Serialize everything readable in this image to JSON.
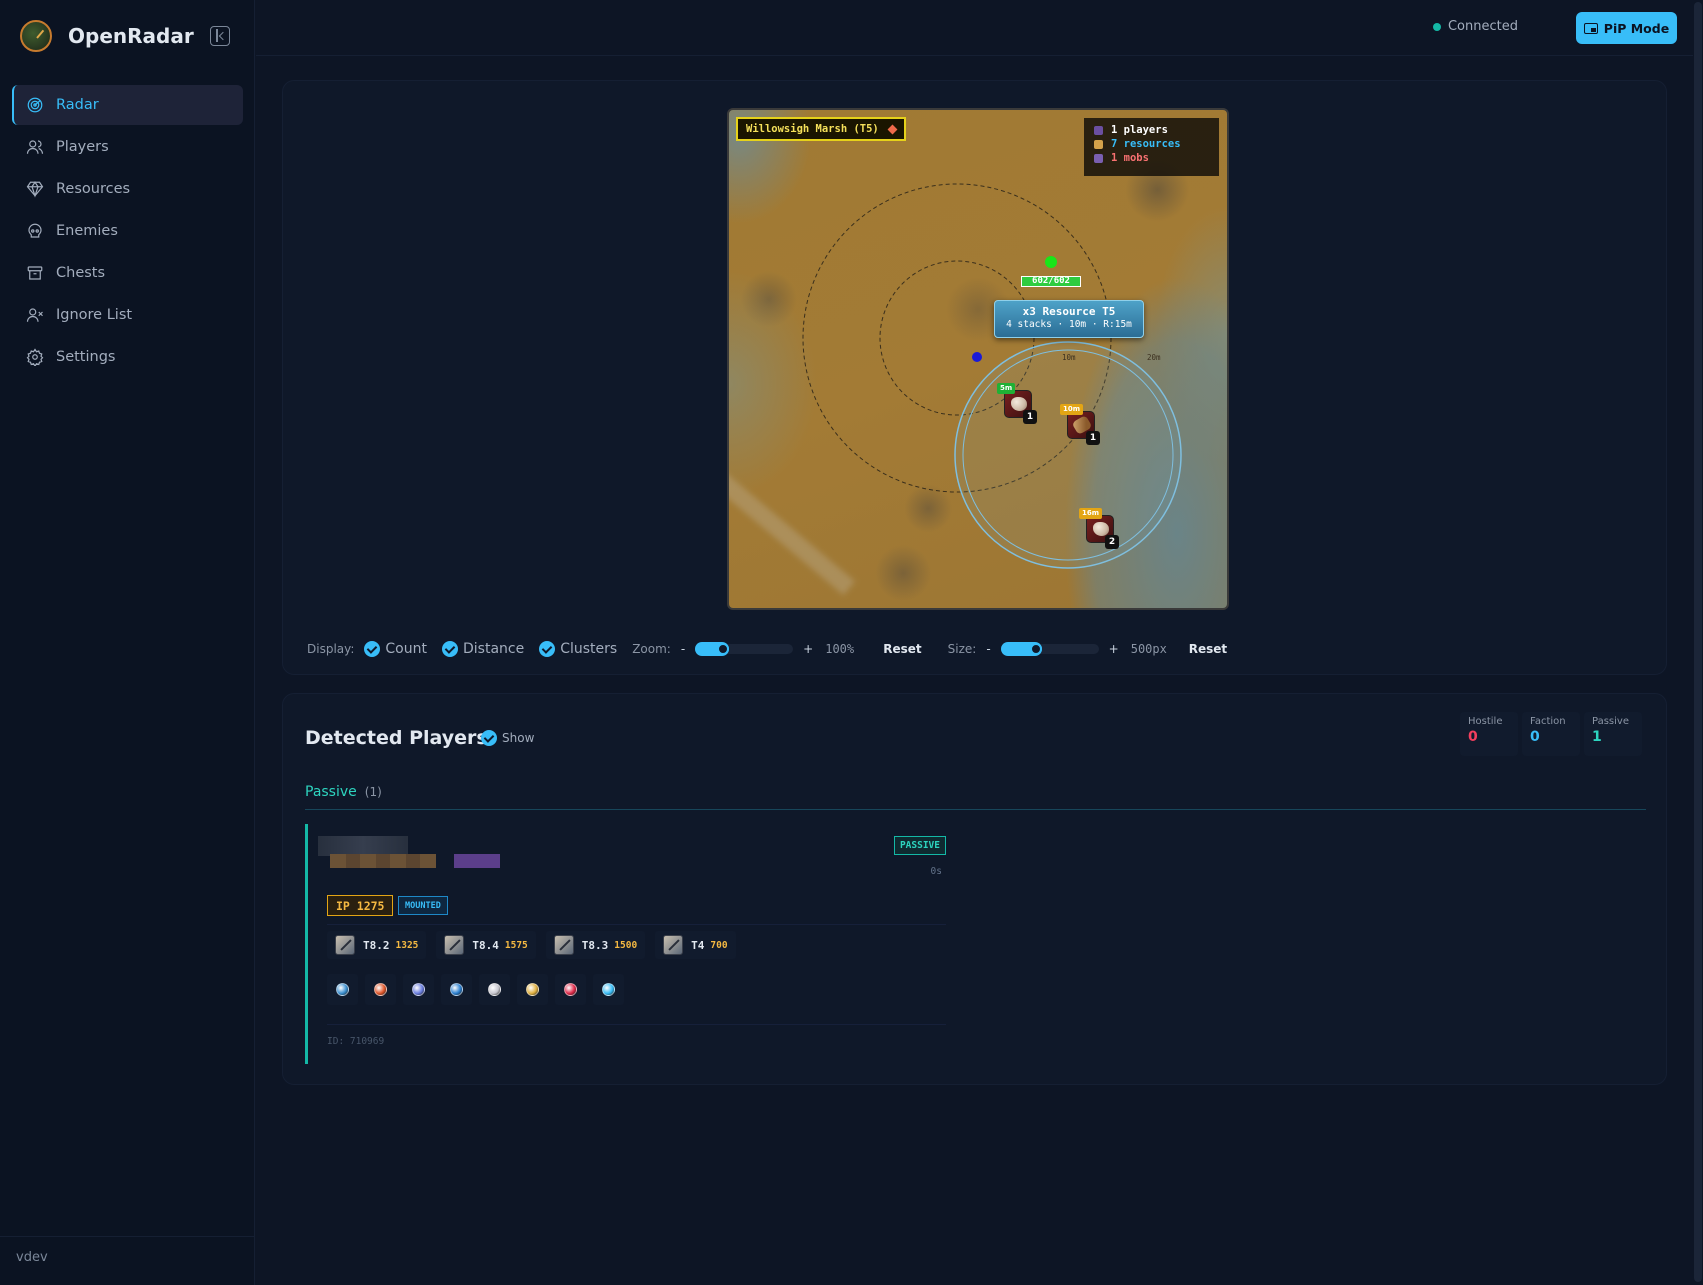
{
  "app": {
    "title": "OpenRadar",
    "version": "vdev"
  },
  "sidebar": {
    "items": [
      {
        "label": "Radar",
        "icon": "radar-icon",
        "active": true
      },
      {
        "label": "Players",
        "icon": "users-icon"
      },
      {
        "label": "Resources",
        "icon": "gem-icon"
      },
      {
        "label": "Enemies",
        "icon": "skull-icon"
      },
      {
        "label": "Chests",
        "icon": "archive-icon"
      },
      {
        "label": "Ignore List",
        "icon": "user-x-icon"
      },
      {
        "label": "Settings",
        "icon": "gear-icon"
      }
    ]
  },
  "topbar": {
    "status": "Connected",
    "pip_label": "PiP Mode"
  },
  "radar": {
    "zone": "Willowsigh Marsh (T5)",
    "legend": {
      "players": "1 players",
      "resources": "7 resources",
      "mobs": "1 mobs"
    },
    "ring_labels": [
      "10m",
      "20m"
    ],
    "hp": "602/602",
    "tooltip_title": "x3 Resource T5",
    "tooltip_sub": "4 stacks · 10m · R:15m",
    "resources": [
      {
        "dist": "5m",
        "count": "1",
        "kind": "rock"
      },
      {
        "dist": "10m",
        "count": "1",
        "kind": "wood"
      },
      {
        "dist": "16m",
        "count": "2",
        "kind": "rock"
      }
    ]
  },
  "controls": {
    "display_label": "Display:",
    "count_label": "Count",
    "distance_label": "Distance",
    "clusters_label": "Clusters",
    "zoom_label": "Zoom:",
    "zoom_value": "100%",
    "zoom_fraction": 0.35,
    "size_label": "Size:",
    "size_value": "500px",
    "size_fraction": 0.42,
    "minus": "-",
    "plus": "+",
    "reset_label": "Reset"
  },
  "players_panel": {
    "title": "Detected Players",
    "show_label": "Show",
    "stats": [
      {
        "label": "Hostile",
        "value": "0",
        "color": "#f43f5e"
      },
      {
        "label": "Faction",
        "value": "0",
        "color": "#38bdf8"
      },
      {
        "label": "Passive",
        "value": "1",
        "color": "#2dd4bf"
      }
    ],
    "tab_label": "Passive",
    "tab_count": "(1)",
    "player": {
      "status": "PASSIVE",
      "age": "0s",
      "ip": "IP 1275",
      "mounted": "MOUNTED",
      "equipment": [
        {
          "tier": "T8.2",
          "ip": "1325"
        },
        {
          "tier": "T8.4",
          "ip": "1575"
        },
        {
          "tier": "T8.3",
          "ip": "1500"
        },
        {
          "tier": "T4",
          "ip": "700"
        }
      ],
      "spells": [
        "#3a8fd0",
        "#e0562a",
        "#6a7ee0",
        "#2a7fd0",
        "#c8c8d0",
        "#e0b040",
        "#e02a4a",
        "#38bdf8"
      ],
      "id": "ID: 710969"
    }
  },
  "colors": {
    "accent": "#38bdf8",
    "passive": "#2dd4bf",
    "hostile": "#f43f5e",
    "background": "#0d1525"
  }
}
